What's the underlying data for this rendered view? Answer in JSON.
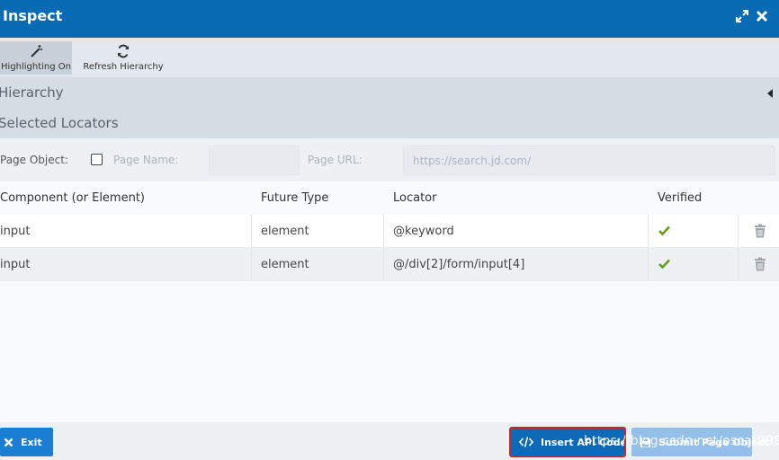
{
  "window": {
    "title": "Inspect"
  },
  "toolbar": {
    "highlighting_label": "Highlighting On",
    "refresh_label": "Refresh Hierarchy"
  },
  "sections": {
    "hierarchy": "Hierarchy",
    "selected_locators": "Selected Locators"
  },
  "page_object": {
    "label": "Page Object:",
    "checked": false,
    "page_name_label": "Page Name:",
    "page_name_value": "",
    "page_url_label": "Page URL:",
    "page_url_placeholder": "https://search.jd.com/"
  },
  "table": {
    "headers": [
      "Component (or Element)",
      "Future Type",
      "Locator",
      "Verified"
    ],
    "rows": [
      {
        "component": "input",
        "type": "element",
        "locator": "@keyword",
        "verified": true
      },
      {
        "component": "input",
        "type": "element",
        "locator": "@/div[2]/form/input[4]",
        "verified": true
      }
    ]
  },
  "footer": {
    "exit_label": "Exit",
    "insert_label": "Insert API Code",
    "submit_label": "Submit Page Object",
    "watermark": "https://blog.csdn.net/oscar999"
  },
  "colors": {
    "titlebar": "#0a6bb5",
    "accent": "#1a7fd4",
    "check_green": "#6a9a1f",
    "highlight_border": "#c8262b"
  }
}
